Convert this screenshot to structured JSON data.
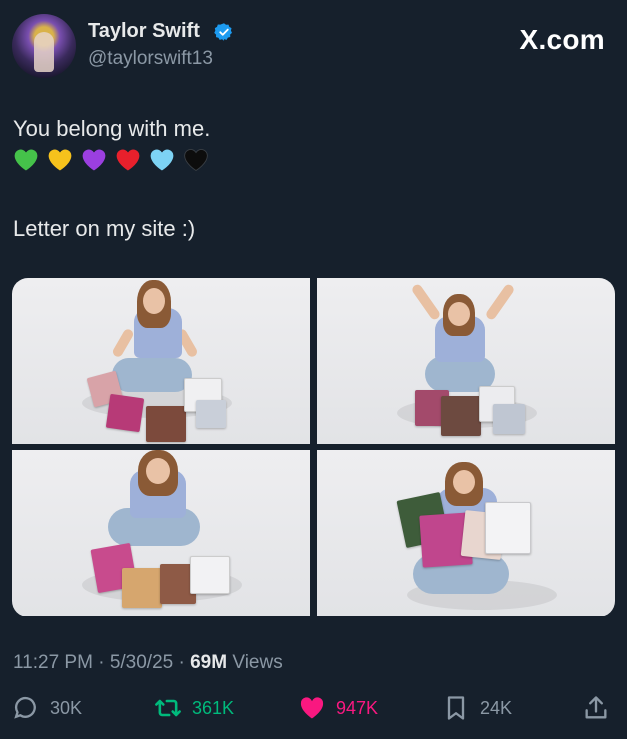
{
  "author": {
    "name": "Taylor Swift",
    "handle": "@taylorswift13",
    "verified": true
  },
  "brand": "X.com",
  "tweet": {
    "line1": "You belong with me.",
    "hearts": [
      {
        "icon": "green-heart-icon",
        "color": "#45c24a"
      },
      {
        "icon": "yellow-heart-icon",
        "color": "#f6c21c"
      },
      {
        "icon": "purple-heart-icon",
        "color": "#9b3fe0"
      },
      {
        "icon": "red-heart-icon",
        "color": "#e8202c"
      },
      {
        "icon": "light-blue-heart-icon",
        "color": "#7dd3f4"
      },
      {
        "icon": "black-heart-icon",
        "color": "#101010"
      }
    ],
    "line2": "Letter on my site :)"
  },
  "meta": {
    "time": "11:27 PM",
    "date": "5/30/25",
    "views_count": "69M",
    "views_label": "Views"
  },
  "actions": {
    "replies": "30K",
    "reposts": "361K",
    "likes": "947K",
    "bookmarks": "24K"
  },
  "colors": {
    "background": "#16202c",
    "repost": "#00ba7c",
    "like": "#f91880",
    "secondary": "#8b98a5",
    "verified": "#1d9bf0"
  }
}
